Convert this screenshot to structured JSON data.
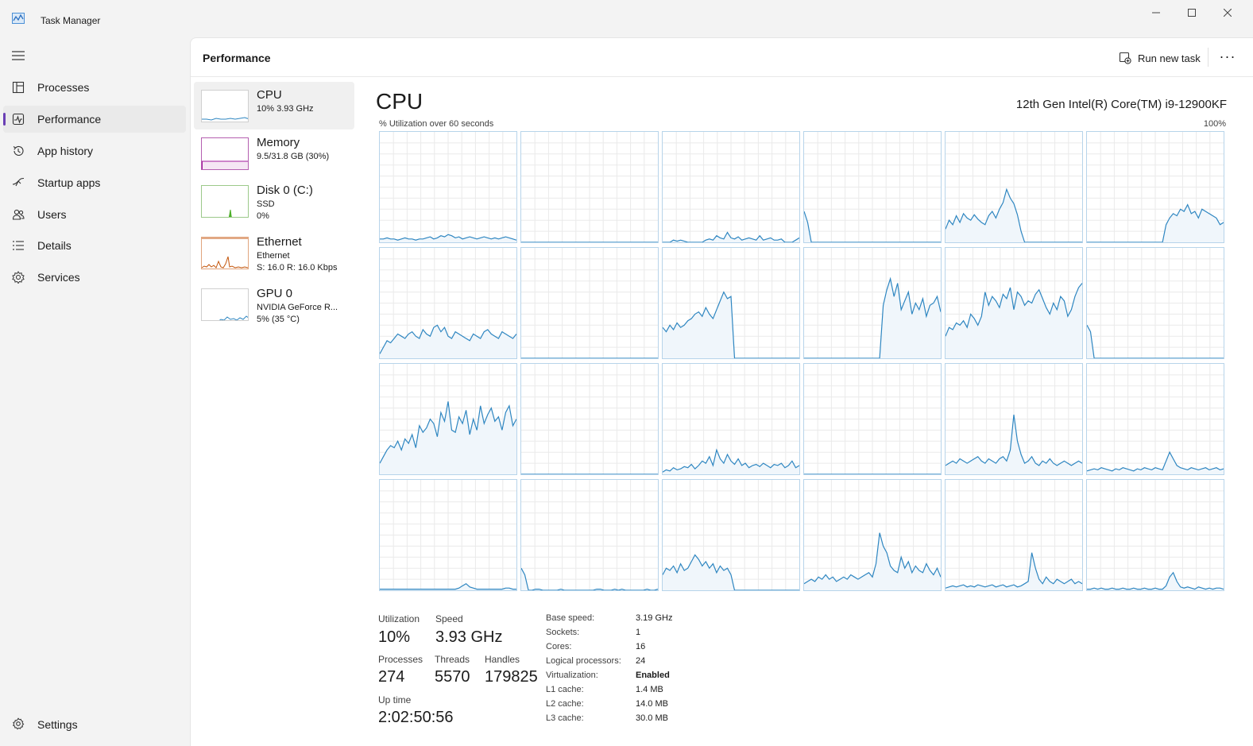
{
  "window": {
    "title": "Task Manager"
  },
  "nav": {
    "items": [
      {
        "label": "Processes",
        "icon": "processes-icon"
      },
      {
        "label": "Performance",
        "icon": "performance-icon",
        "active": true
      },
      {
        "label": "App history",
        "icon": "history-icon"
      },
      {
        "label": "Startup apps",
        "icon": "startup-icon"
      },
      {
        "label": "Users",
        "icon": "users-icon"
      },
      {
        "label": "Details",
        "icon": "details-icon"
      },
      {
        "label": "Services",
        "icon": "services-icon"
      }
    ],
    "settings_label": "Settings"
  },
  "header": {
    "title": "Performance",
    "run_new_task": "Run new task",
    "more": "···"
  },
  "resources": [
    {
      "title": "CPU",
      "line1": "10%  3.93 GHz",
      "line2": "",
      "color": "#2e86c1"
    },
    {
      "title": "Memory",
      "line1": "9.5/31.8 GB (30%)",
      "line2": "",
      "color": "#a21a9c"
    },
    {
      "title": "Disk 0 (C:)",
      "line1": "SSD",
      "line2": "0%",
      "color": "#4caf28"
    },
    {
      "title": "Ethernet",
      "line1": "Ethernet",
      "line2": "S: 16.0  R: 16.0 Kbps",
      "color": "#c4560c"
    },
    {
      "title": "GPU 0",
      "line1": "NVIDIA GeForce R...",
      "line2": "5%  (35 °C)",
      "color": "#2e86c1"
    }
  ],
  "cpu": {
    "title": "CPU",
    "model": "12th Gen Intel(R) Core(TM) i9-12900KF",
    "util_label": "% Utilization over 60 seconds",
    "util_max": "100%",
    "line_color": "#2e86c1",
    "fill_color": "#f0f6fb",
    "cores": [
      [
        3,
        3,
        4,
        3,
        3,
        2,
        3,
        4,
        3,
        3,
        2,
        3,
        3,
        4,
        5,
        3,
        4,
        6,
        5,
        7,
        6,
        4,
        5,
        3,
        4,
        5,
        4,
        3,
        4,
        5,
        4,
        3,
        4,
        3,
        4,
        5,
        4,
        3,
        2
      ],
      [
        0,
        0,
        0,
        0,
        0,
        0,
        0,
        0,
        0,
        0,
        0,
        0,
        0,
        0,
        0,
        0,
        0,
        0,
        0,
        0,
        0,
        0,
        0,
        0,
        0,
        0,
        0,
        0,
        0,
        0,
        0,
        0,
        0,
        0,
        0,
        0,
        0,
        0,
        0
      ],
      [
        0,
        0,
        0,
        2,
        1,
        2,
        1,
        0,
        0,
        0,
        0,
        0,
        2,
        3,
        2,
        6,
        4,
        3,
        9,
        4,
        3,
        5,
        2,
        3,
        4,
        3,
        2,
        6,
        2,
        3,
        4,
        2,
        2,
        3,
        0,
        0,
        0,
        2,
        4
      ],
      [
        28,
        18,
        0,
        0,
        0,
        0,
        0,
        0,
        0,
        0,
        0,
        0,
        0,
        0,
        0,
        0,
        0,
        0,
        0,
        0,
        0,
        0,
        0,
        0,
        0,
        0,
        0,
        0,
        0,
        0,
        0,
        0,
        0,
        0,
        0,
        0,
        0,
        0,
        0
      ],
      [
        12,
        20,
        16,
        24,
        18,
        26,
        22,
        20,
        25,
        21,
        18,
        16,
        24,
        28,
        22,
        30,
        36,
        48,
        40,
        35,
        25,
        10,
        0,
        0,
        0,
        0,
        0,
        0,
        0,
        0,
        0,
        0,
        0,
        0,
        0,
        0,
        0,
        0,
        0
      ],
      [
        0,
        0,
        0,
        0,
        0,
        0,
        0,
        0,
        0,
        0,
        0,
        0,
        0,
        0,
        0,
        0,
        0,
        0,
        0,
        0,
        0,
        0,
        16,
        22,
        26,
        24,
        30,
        28,
        34,
        26,
        28,
        22,
        30,
        28,
        26,
        24,
        22,
        16,
        18
      ],
      [
        4,
        10,
        16,
        14,
        18,
        22,
        20,
        18,
        22,
        24,
        20,
        18,
        26,
        22,
        20,
        28,
        30,
        24,
        28,
        20,
        18,
        24,
        22,
        20,
        18,
        16,
        22,
        20,
        18,
        24,
        26,
        22,
        20,
        18,
        24,
        22,
        20,
        18,
        22
      ],
      [
        0,
        0,
        0,
        0,
        0,
        0,
        0,
        0,
        0,
        0,
        0,
        0,
        0,
        0,
        0,
        0,
        0,
        0,
        0,
        0,
        0,
        0,
        0,
        0,
        0,
        0,
        0,
        0,
        0,
        0,
        0,
        0,
        0,
        0,
        0,
        0,
        0,
        0,
        0
      ],
      [
        28,
        24,
        30,
        26,
        32,
        28,
        30,
        34,
        36,
        40,
        42,
        38,
        46,
        40,
        36,
        44,
        52,
        60,
        54,
        56,
        0,
        0,
        0,
        0,
        0,
        0,
        0,
        0,
        0,
        0,
        0,
        0,
        0,
        0,
        0,
        0,
        0,
        0,
        0
      ],
      [
        0,
        0,
        0,
        0,
        0,
        0,
        0,
        0,
        0,
        0,
        0,
        0,
        0,
        0,
        0,
        0,
        0,
        0,
        0,
        0,
        0,
        0,
        48,
        62,
        72,
        56,
        68,
        44,
        52,
        60,
        40,
        50,
        44,
        54,
        38,
        48,
        50,
        56,
        42
      ],
      [
        20,
        28,
        26,
        32,
        30,
        34,
        28,
        40,
        36,
        30,
        38,
        60,
        48,
        56,
        52,
        46,
        58,
        54,
        64,
        44,
        60,
        56,
        48,
        52,
        50,
        58,
        62,
        54,
        46,
        40,
        50,
        44,
        56,
        52,
        38,
        44,
        56,
        64,
        68
      ],
      [
        30,
        24,
        0,
        0,
        0,
        0,
        0,
        0,
        0,
        0,
        0,
        0,
        0,
        0,
        0,
        0,
        0,
        0,
        0,
        0,
        0,
        0,
        0,
        0,
        0,
        0,
        0,
        0,
        0,
        0,
        0,
        0,
        0,
        0,
        0,
        0,
        0,
        0,
        0
      ],
      [
        10,
        16,
        22,
        26,
        24,
        30,
        22,
        32,
        28,
        36,
        24,
        44,
        38,
        42,
        50,
        46,
        34,
        56,
        48,
        66,
        40,
        38,
        52,
        46,
        58,
        36,
        50,
        40,
        62,
        46,
        54,
        60,
        48,
        52,
        40,
        56,
        62,
        44,
        50
      ],
      [
        0,
        0,
        0,
        0,
        0,
        0,
        0,
        0,
        0,
        0,
        0,
        0,
        0,
        0,
        0,
        0,
        0,
        0,
        0,
        0,
        0,
        0,
        0,
        0,
        0,
        0,
        0,
        0,
        0,
        0,
        0,
        0,
        0,
        0,
        0,
        0,
        0,
        0,
        0
      ],
      [
        2,
        4,
        3,
        6,
        4,
        5,
        7,
        6,
        9,
        5,
        8,
        12,
        10,
        16,
        8,
        22,
        14,
        10,
        18,
        12,
        9,
        14,
        8,
        10,
        6,
        8,
        9,
        7,
        10,
        8,
        6,
        9,
        8,
        10,
        6,
        8,
        12,
        6,
        8
      ],
      [
        0,
        0,
        0,
        0,
        0,
        0,
        0,
        0,
        0,
        0,
        0,
        0,
        0,
        0,
        0,
        0,
        0,
        0,
        0,
        0,
        0,
        0,
        0,
        0,
        0,
        0,
        0,
        0,
        0,
        0,
        0,
        0,
        0,
        0,
        0,
        0,
        0,
        0,
        0
      ],
      [
        8,
        10,
        12,
        10,
        14,
        12,
        10,
        12,
        14,
        16,
        12,
        10,
        14,
        12,
        10,
        14,
        16,
        12,
        22,
        54,
        30,
        18,
        10,
        12,
        16,
        10,
        8,
        12,
        10,
        14,
        10,
        8,
        10,
        12,
        10,
        8,
        10,
        12,
        10
      ],
      [
        3,
        4,
        5,
        4,
        6,
        5,
        4,
        3,
        5,
        4,
        6,
        5,
        4,
        3,
        5,
        4,
        6,
        5,
        4,
        6,
        5,
        4,
        12,
        20,
        14,
        8,
        6,
        5,
        4,
        6,
        5,
        4,
        5,
        6,
        4,
        5,
        6,
        4,
        5
      ],
      [
        1,
        1,
        1,
        1,
        1,
        1,
        1,
        1,
        1,
        1,
        1,
        1,
        1,
        1,
        1,
        1,
        1,
        1,
        1,
        1,
        1,
        1,
        2,
        4,
        6,
        3,
        2,
        1,
        1,
        1,
        1,
        1,
        1,
        1,
        1,
        2,
        2,
        1,
        1
      ],
      [
        20,
        14,
        0,
        0,
        1,
        1,
        0,
        0,
        0,
        0,
        0,
        1,
        0,
        0,
        0,
        0,
        0,
        0,
        0,
        0,
        0,
        1,
        1,
        0,
        0,
        0,
        1,
        0,
        1,
        0,
        0,
        0,
        0,
        0,
        0,
        1,
        0,
        0,
        1
      ],
      [
        14,
        20,
        18,
        22,
        16,
        24,
        18,
        20,
        26,
        32,
        28,
        22,
        26,
        20,
        24,
        16,
        22,
        18,
        20,
        14,
        0,
        0,
        0,
        0,
        0,
        0,
        0,
        0,
        0,
        0,
        0,
        0,
        0,
        0,
        0,
        0,
        0,
        0,
        0
      ],
      [
        6,
        8,
        10,
        8,
        12,
        10,
        14,
        10,
        12,
        8,
        10,
        12,
        10,
        14,
        12,
        10,
        12,
        14,
        16,
        12,
        24,
        52,
        40,
        34,
        22,
        18,
        16,
        30,
        20,
        26,
        16,
        22,
        18,
        16,
        24,
        18,
        14,
        20,
        12
      ],
      [
        2,
        3,
        4,
        3,
        4,
        5,
        3,
        4,
        3,
        5,
        4,
        3,
        4,
        5,
        3,
        4,
        5,
        3,
        4,
        5,
        3,
        4,
        6,
        8,
        34,
        20,
        10,
        6,
        12,
        8,
        6,
        10,
        8,
        6,
        8,
        10,
        6,
        8,
        6
      ],
      [
        1,
        1,
        2,
        1,
        2,
        1,
        1,
        2,
        1,
        1,
        2,
        1,
        1,
        2,
        1,
        1,
        2,
        1,
        1,
        2,
        1,
        1,
        4,
        12,
        16,
        8,
        3,
        2,
        3,
        2,
        1,
        3,
        2,
        1,
        2,
        1,
        2,
        2,
        1
      ]
    ]
  },
  "stats": {
    "utilization_label": "Utilization",
    "utilization": "10%",
    "speed_label": "Speed",
    "speed": "3.93 GHz",
    "processes_label": "Processes",
    "processes": "274",
    "threads_label": "Threads",
    "threads": "5570",
    "handles_label": "Handles",
    "handles": "179825",
    "uptime_label": "Up time",
    "uptime": "2:02:50:56"
  },
  "specs": [
    {
      "key": "Base speed:",
      "value": "3.19 GHz"
    },
    {
      "key": "Sockets:",
      "value": "1"
    },
    {
      "key": "Cores:",
      "value": "16"
    },
    {
      "key": "Logical processors:",
      "value": "24"
    },
    {
      "key": "Virtualization:",
      "value": "Enabled"
    },
    {
      "key": "L1 cache:",
      "value": "1.4 MB"
    },
    {
      "key": "L2 cache:",
      "value": "14.0 MB"
    },
    {
      "key": "L3 cache:",
      "value": "30.0 MB"
    }
  ]
}
